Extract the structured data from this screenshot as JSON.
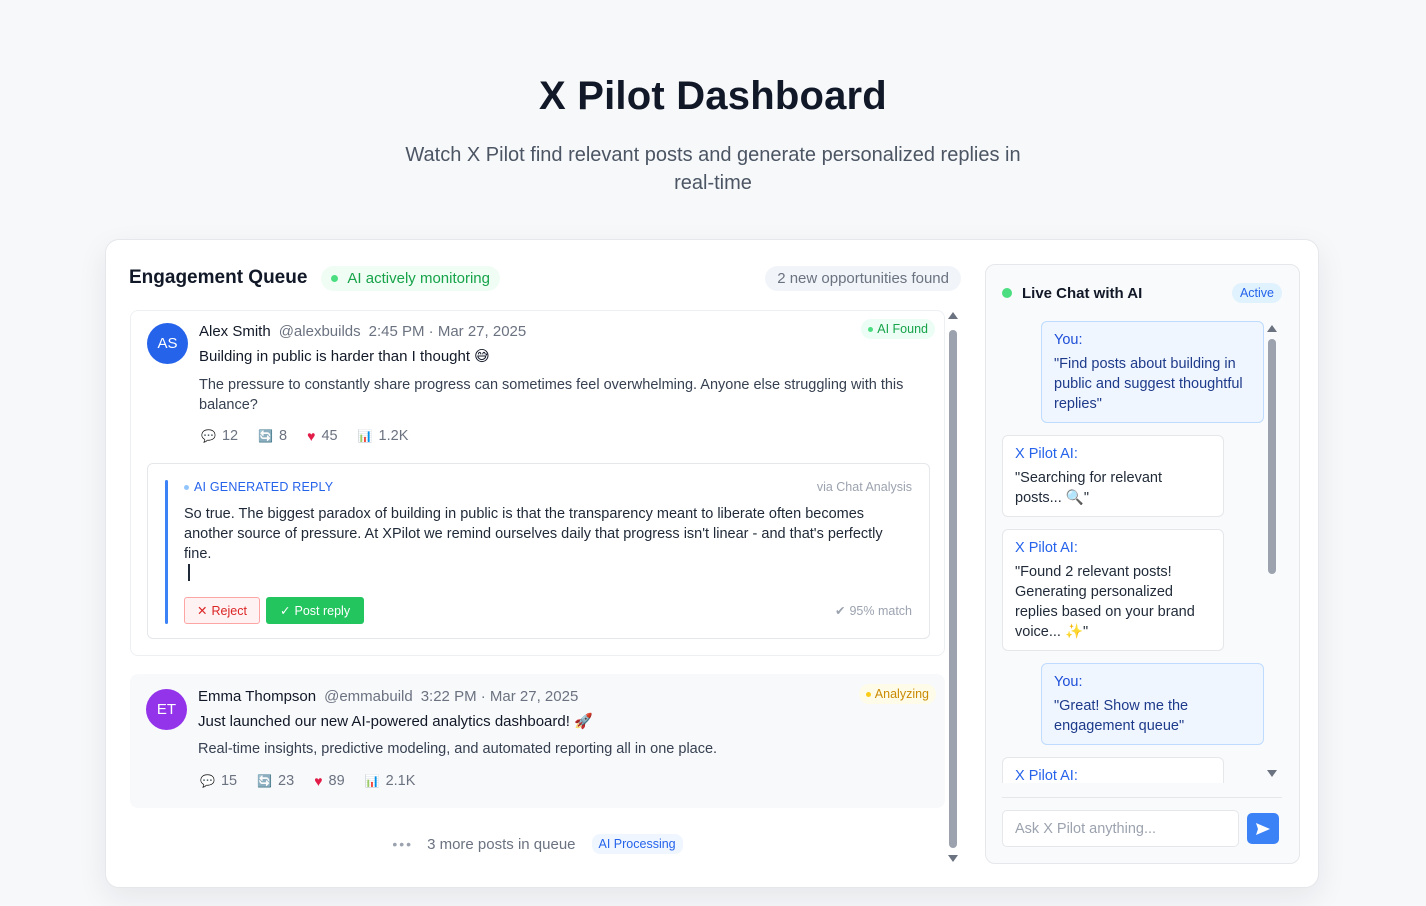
{
  "hero": {
    "title": "X Pilot Dashboard",
    "subtitle": "Watch X Pilot find relevant posts and generate personalized replies in real-time"
  },
  "queue": {
    "title": "Engagement Queue",
    "monitor_label": "AI actively monitoring",
    "found_label": "2 new opportunities found",
    "posts": [
      {
        "initials": "AS",
        "name": "Alex Smith",
        "handle": "@alexbuilds",
        "time": "2:45 PM · Mar 27, 2025",
        "headline": "Building in public is harder than I thought 😅",
        "body": "The pressure to constantly share progress can sometimes feel overwhelming. Anyone else struggling with this balance?",
        "badge": "AI Found",
        "stats": {
          "comments": "12",
          "retweets": "8",
          "likes": "45",
          "views": "1.2K"
        },
        "reply": {
          "label": "AI GENERATED REPLY",
          "via": "via Chat Analysis",
          "text": "So true. The biggest paradox of building in public is that the transparency meant to liberate often becomes another source of pressure. At XPilot we remind ourselves daily that progress isn't linear - and that's perfectly fine.",
          "reject_label": "Reject",
          "post_label": "Post reply",
          "match": "95% match"
        }
      },
      {
        "initials": "ET",
        "name": "Emma Thompson",
        "handle": "@emmabuild",
        "time": "3:22 PM · Mar 27, 2025",
        "headline": "Just launched our new AI-powered analytics dashboard! 🚀",
        "body": "Real-time insights, predictive modeling, and automated reporting all in one place.",
        "badge": "Analyzing",
        "stats": {
          "comments": "15",
          "retweets": "23",
          "likes": "89",
          "views": "2.1K"
        }
      }
    ],
    "more_label": "3 more posts in queue",
    "processing_label": "AI Processing"
  },
  "chat": {
    "title": "Live Chat with AI",
    "status": "Active",
    "messages": [
      {
        "who": "You:",
        "text": "\"Find posts about building in public and suggest thoughtful replies\""
      },
      {
        "who": "X Pilot AI:",
        "text": "\"Searching for relevant posts... 🔍\""
      },
      {
        "who": "X Pilot AI:",
        "text": "\"Found 2 relevant posts! Generating personalized replies based on your brand voice... ✨\""
      },
      {
        "who": "You:",
        "text": "\"Great! Show me the engagement queue\""
      },
      {
        "who": "X Pilot AI:",
        "text": ""
      }
    ],
    "input_placeholder": "Ask X Pilot anything..."
  },
  "colors": {
    "accent": "#3b82f6",
    "success": "#22c55e",
    "danger": "#dc2626",
    "avatar_1": "#2563eb",
    "avatar_2": "#9333ea"
  },
  "icons": [
    "comment-icon",
    "retweet-icon",
    "heart-icon",
    "views-icon",
    "check-circle-icon",
    "send-icon",
    "close-icon",
    "check-icon"
  ]
}
